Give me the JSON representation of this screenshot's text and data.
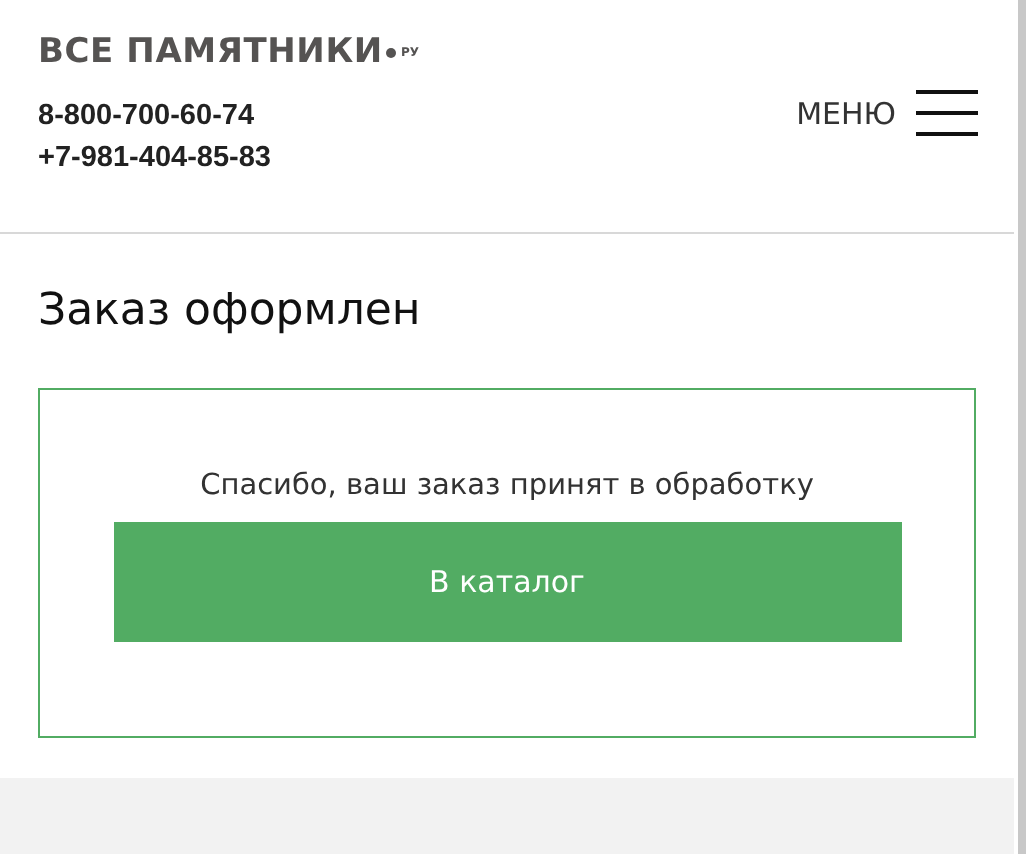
{
  "header": {
    "logo": {
      "name": "ВСЕ ПАМЯТНИКИ",
      "suffix": "РУ"
    },
    "phones": [
      "8-800-700-60-74",
      "+7-981-404-85-83"
    ],
    "menu_label": "МЕНЮ"
  },
  "title": "Заказ оформлен",
  "confirmation": {
    "message": "Спасибо, ваш заказ принят в обработку",
    "button": "В каталог"
  }
}
